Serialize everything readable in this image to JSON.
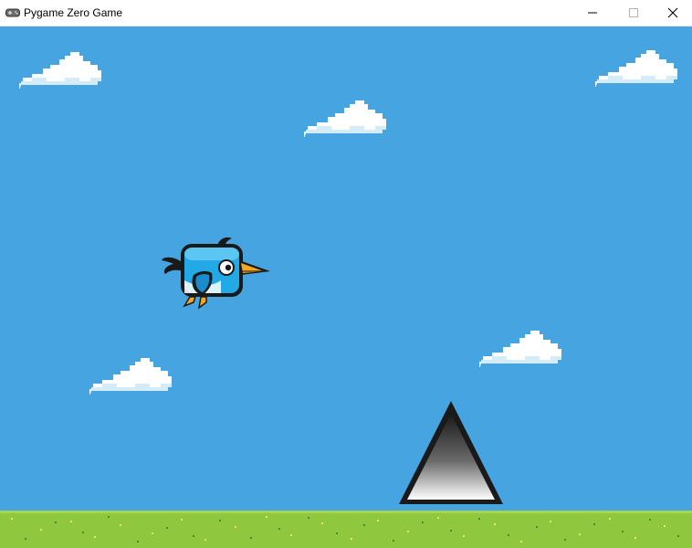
{
  "window": {
    "title": "Pygame Zero Game",
    "icon": "gamepad-icon",
    "controls": [
      "minimize-icon",
      "maximize-icon",
      "close-icon"
    ]
  },
  "scene": {
    "sky_color": "#46a5e0",
    "ground_color": "#8fc73f",
    "cloud_color": "#ffffff",
    "cloud_shadow_color": "#d3ecf8",
    "bird_body_color": "#22a9e6",
    "bird_beak_color": "#f5a623",
    "spike_color": "#1a1a1a",
    "cloud_count": 5,
    "sprites": [
      "bird",
      "spike",
      "ground"
    ]
  }
}
